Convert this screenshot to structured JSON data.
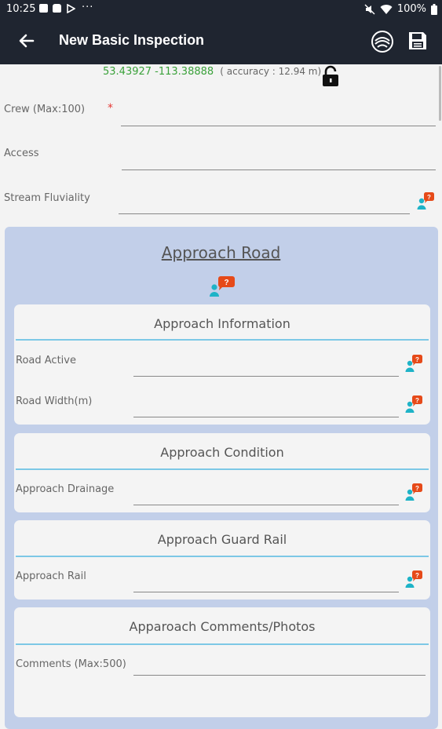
{
  "status_bar": {
    "time": "10:25",
    "dots": "···",
    "battery": "100%"
  },
  "app_bar": {
    "title": "New Basic Inspection"
  },
  "gps": {
    "coords": "53.43927 -113.38888",
    "accuracy": "( accuracy : 12.94 m)"
  },
  "fields": {
    "crew_label": "Crew (Max:100)",
    "crew_required": "*",
    "access_label": "Access",
    "stream_label": "Stream Fluviality"
  },
  "approach_road": {
    "title": "Approach Road",
    "information": {
      "title": "Approach Information",
      "road_active_label": "Road Active",
      "road_width_label": "Road Width(m)"
    },
    "condition": {
      "title": "Approach Condition",
      "drainage_label": "Approach Drainage"
    },
    "guard_rail": {
      "title": "Approach Guard Rail",
      "rail_label": "Approach Rail"
    },
    "comments": {
      "title": "Apparoach Comments/Photos",
      "comments_label": "Comments (Max:500)"
    }
  },
  "help_badge": "?",
  "colors": {
    "app_bar": "#1f2530",
    "gps_green": "#3aa13a",
    "panel": "#c2cfe9",
    "separator": "#7dc8e6",
    "help_person": "#1eb3c7",
    "help_badge": "#e64a19",
    "required": "#e53935"
  }
}
